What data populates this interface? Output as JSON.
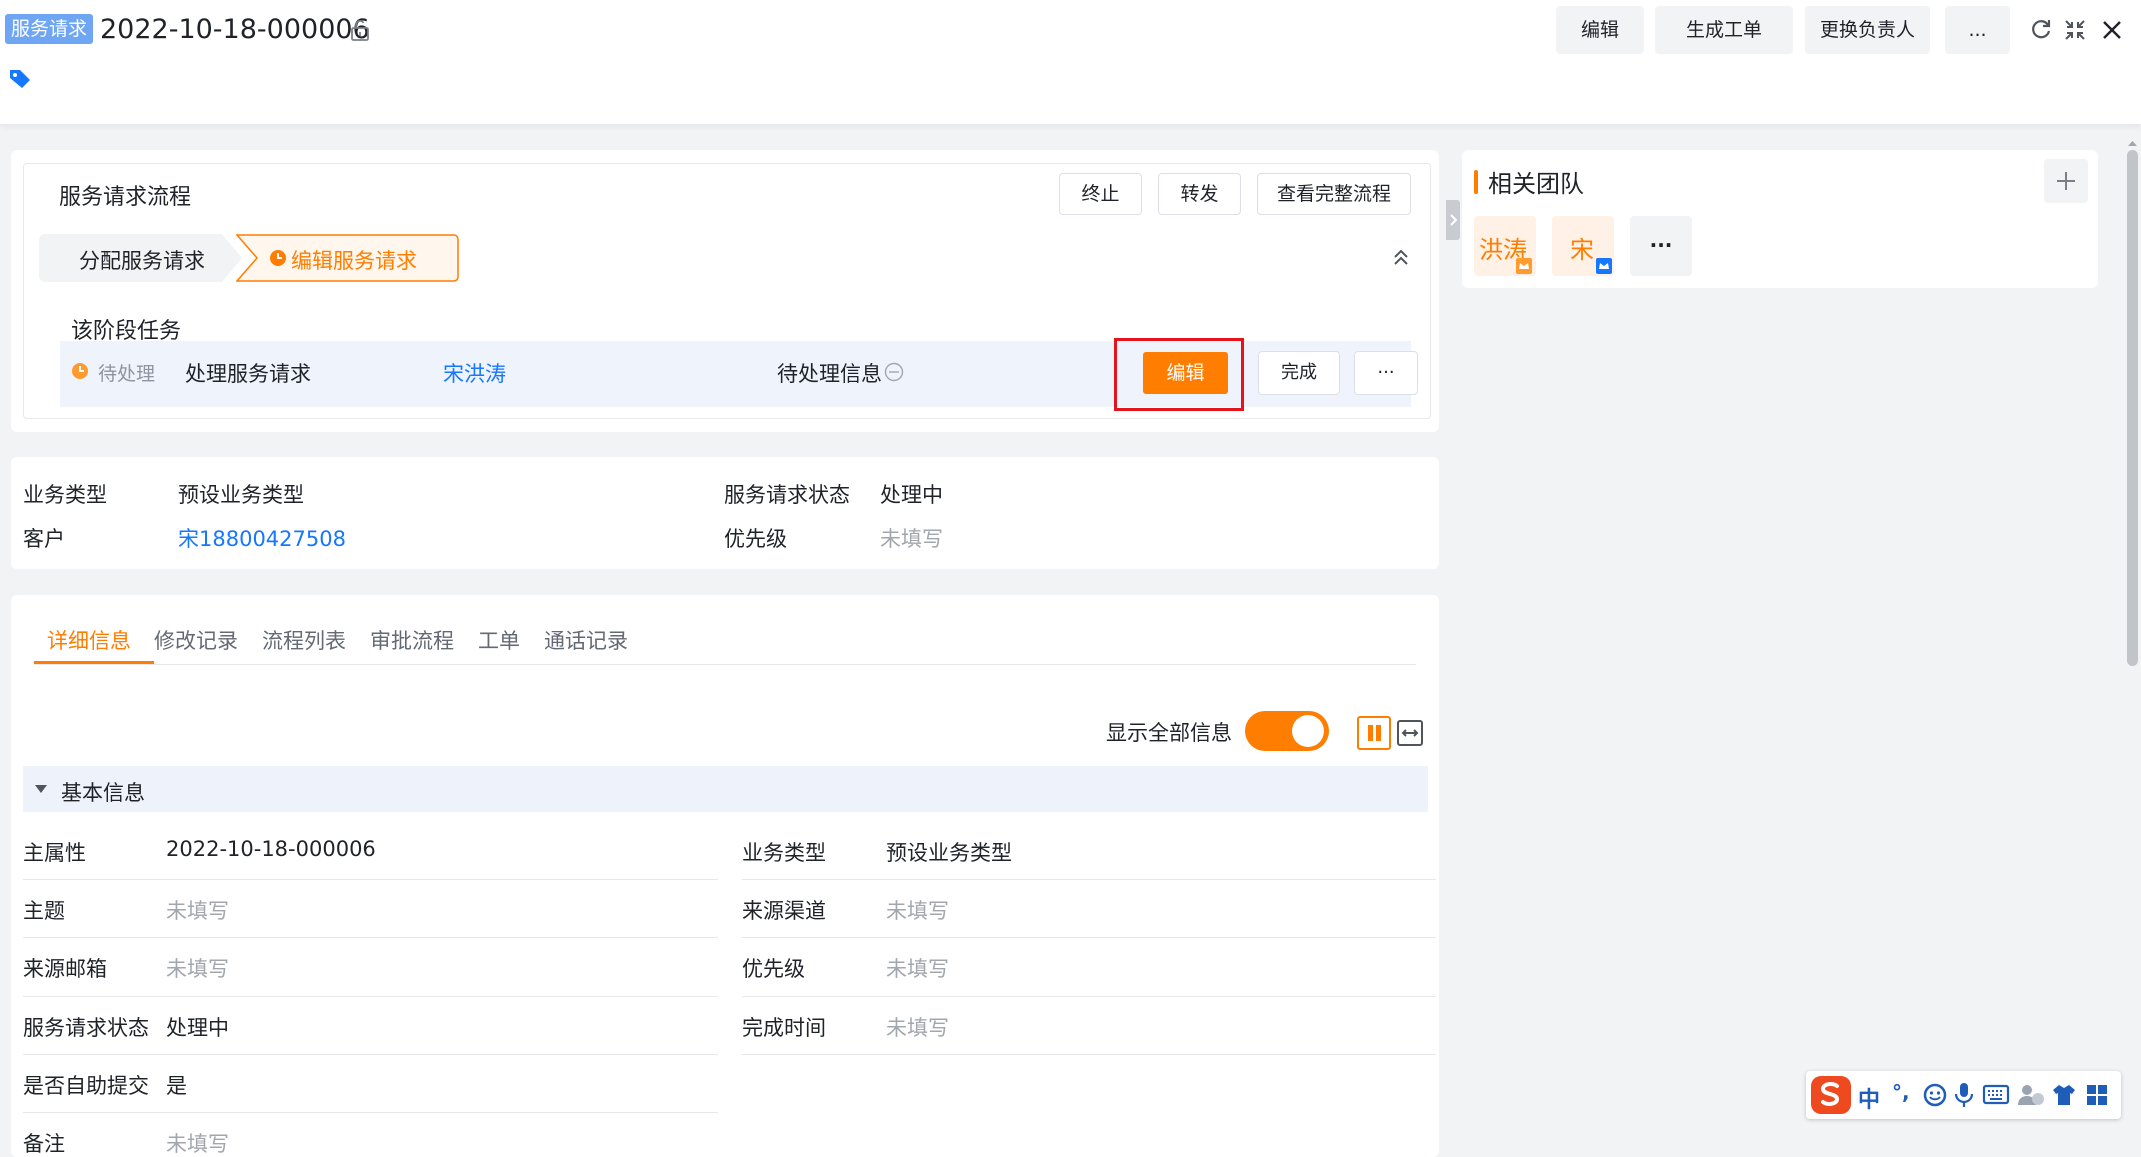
{
  "header": {
    "badge": "服务请求",
    "title": "2022-10-18-000006",
    "buttons": {
      "edit": "编辑",
      "gen_order": "生成工单",
      "change_owner": "更换负责人",
      "more": "..."
    }
  },
  "flow": {
    "title": "服务请求流程",
    "buttons": {
      "terminate": "终止",
      "forward": "转发",
      "view_full": "查看完整流程"
    },
    "stages": [
      {
        "label": "分配服务请求",
        "state": "done"
      },
      {
        "label": "编辑服务请求",
        "state": "active"
      }
    ],
    "task_section_title": "该阶段任务",
    "task": {
      "status": "待处理",
      "name": "处理服务请求",
      "assignee": "宋洪涛",
      "info": "待处理信息",
      "edit_btn": "编辑",
      "complete_btn": "完成",
      "more_btn": "···"
    }
  },
  "summary": {
    "left": [
      {
        "label": "业务类型",
        "value": "预设业务类型"
      },
      {
        "label": "客户",
        "value": "宋18800427508"
      }
    ],
    "right": [
      {
        "label": "服务请求状态",
        "value": "处理中"
      },
      {
        "label": "优先级",
        "value": "未填写"
      }
    ]
  },
  "tabs": [
    "详细信息",
    "修改记录",
    "流程列表",
    "审批流程",
    "工单",
    "通话记录"
  ],
  "active_tab": "详细信息",
  "show_all": {
    "label": "显示全部信息",
    "on": true
  },
  "section": {
    "title": "基本信息"
  },
  "fields_left": [
    {
      "label": "主属性",
      "value": "2022-10-18-000006"
    },
    {
      "label": "主题",
      "value": "未填写"
    },
    {
      "label": "来源邮箱",
      "value": "未填写"
    },
    {
      "label": "服务请求状态",
      "value": "处理中"
    },
    {
      "label": "是否自助提交",
      "value": "是"
    },
    {
      "label": "备注",
      "value": "未填写"
    }
  ],
  "fields_right": [
    {
      "label": "业务类型",
      "value": "预设业务类型"
    },
    {
      "label": "来源渠道",
      "value": "未填写"
    },
    {
      "label": "优先级",
      "value": "未填写"
    },
    {
      "label": "完成时间",
      "value": "未填写"
    }
  ],
  "team": {
    "title": "相关团队",
    "members": [
      {
        "name": "洪涛"
      },
      {
        "name": "宋"
      }
    ],
    "more": "···"
  },
  "ime": {
    "chinese": "中",
    "punct": "°,"
  },
  "colors": {
    "accent": "#ff7d00",
    "link": "#1677ff",
    "badge": "#6fa6f4",
    "highlight_box": "#e5141c"
  }
}
